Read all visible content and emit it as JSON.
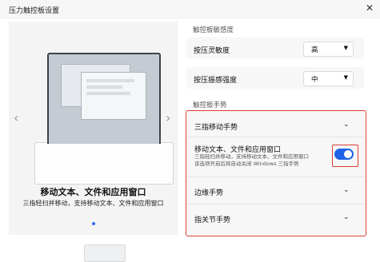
{
  "window": {
    "title": "压力触控板设置",
    "close_icon": "close-icon"
  },
  "preview": {
    "heading": "移动文本、文件和应用窗口",
    "description": "三指轻扫并移动，支持移动文本、文件和应用窗口",
    "prev_icon": "chevron-left-icon",
    "next_icon": "chevron-right-icon",
    "accent": "#2a6ef0"
  },
  "sensitivity": {
    "section_title": "触控板敏感度",
    "press_sensitivity": {
      "label": "按压灵敏度",
      "value": "高"
    },
    "press_vibration": {
      "label": "按压振感强度",
      "value": "中"
    }
  },
  "gestures": {
    "section_title": "触控板手势",
    "three_finger": {
      "label": "三指移动手势"
    },
    "move_toggle": {
      "label": "移动文本、文件和应用窗口",
      "desc_line1": "三指轻扫并移动，支持移动文本、文件和应用窗口",
      "desc_line2": "该选项开启后将自动关闭 Windows 三指手势",
      "enabled": true,
      "color": "#1f63e6"
    },
    "edge": {
      "label": "边缘手势"
    },
    "knuckle": {
      "label": "指关节手势"
    }
  },
  "highlight_color": "#d93b33"
}
